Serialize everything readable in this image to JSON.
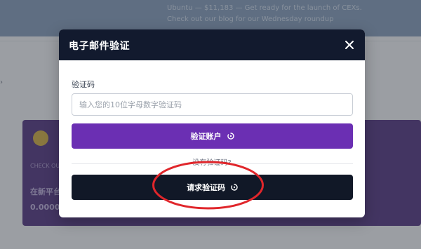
{
  "background": {
    "announcement": "Ubuntu — $11,183 — Get ready for the launch of CEXs. Check out our blog for our Wednesday roundup",
    "card_line_1": "CHECK OUT THE MOST RECENT",
    "card_line_2": "在新平台赚取比特币",
    "card_line_3": "0.0000"
  },
  "modal": {
    "title": "电子邮件验证",
    "close_icon": "close-icon",
    "field_label": "验证码",
    "input_placeholder": "输入您的10位字母数字验证码",
    "input_value": "",
    "verify_button_label": "验证账户",
    "no_code_text": "没有验证码?",
    "request_button_label": "请求验证码",
    "button_icon": "spinner-icon"
  },
  "colors": {
    "header": "#121a2e",
    "verify_button": "#6b2fb3",
    "request_button": "#111827",
    "annotation": "#e0262b"
  }
}
